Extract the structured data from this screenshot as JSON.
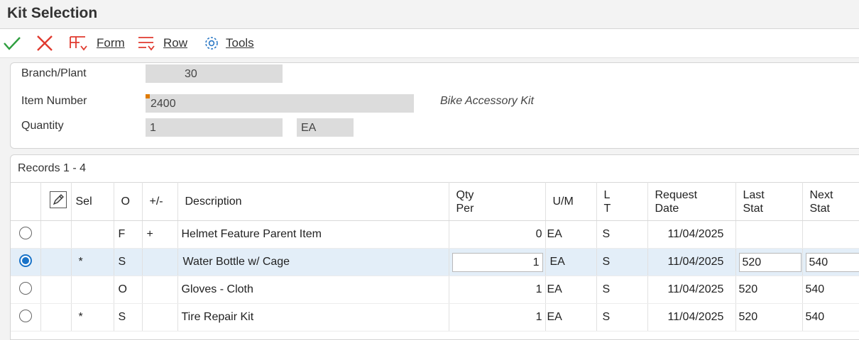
{
  "window": {
    "title": "Kit Selection"
  },
  "toolbar": {
    "ok_icon": "checkmark-icon",
    "cancel_icon": "close-icon",
    "form_label": "Form",
    "row_label": "Row",
    "tools_label": "Tools"
  },
  "header": {
    "branch_plant_label": "Branch/Plant",
    "branch_plant_value": "30",
    "item_number_label": "Item Number",
    "item_number_value": "2400",
    "item_description": "Bike Accessory Kit",
    "quantity_label": "Quantity",
    "quantity_value": "1",
    "quantity_uom": "EA"
  },
  "grid": {
    "records": "Records 1 - 4",
    "columns": {
      "sel": "Sel",
      "o": "O",
      "plusminus": "+/-",
      "description": "Description",
      "qty_per_1": "Qty",
      "qty_per_2": "Per",
      "um": "U/M",
      "lt_1": "L",
      "lt_2": "T",
      "req_date_1": "Request",
      "req_date_2": "Date",
      "last_stat_1": "Last",
      "last_stat_2": "Stat",
      "next_stat_1": "Next",
      "next_stat_2": "Stat"
    },
    "rows": [
      {
        "selected": false,
        "sel": "",
        "o": "F",
        "pm": "+",
        "description": "Helmet Feature Parent Item",
        "qty": "0",
        "um": "EA",
        "lt": "S",
        "date": "11/04/2025",
        "last": "",
        "next": ""
      },
      {
        "selected": true,
        "sel": "*",
        "o": "S",
        "pm": "",
        "description": "Water Bottle w/ Cage",
        "qty": "1",
        "um": "EA",
        "lt": "S",
        "date": "11/04/2025",
        "last": "520",
        "next": "540"
      },
      {
        "selected": false,
        "sel": "",
        "o": "O",
        "pm": "",
        "description": "Gloves - Cloth",
        "qty": "1",
        "um": "EA",
        "lt": "S",
        "date": "11/04/2025",
        "last": "520",
        "next": "540"
      },
      {
        "selected": false,
        "sel": "*",
        "o": "S",
        "pm": "",
        "description": "Tire Repair Kit",
        "qty": "1",
        "um": "EA",
        "lt": "S",
        "date": "11/04/2025",
        "last": "520",
        "next": "540"
      }
    ]
  },
  "colors": {
    "accent": "#1a73c8",
    "ok": "#2e9e3e",
    "cancel": "#e03a2f",
    "required": "#e07b00"
  }
}
